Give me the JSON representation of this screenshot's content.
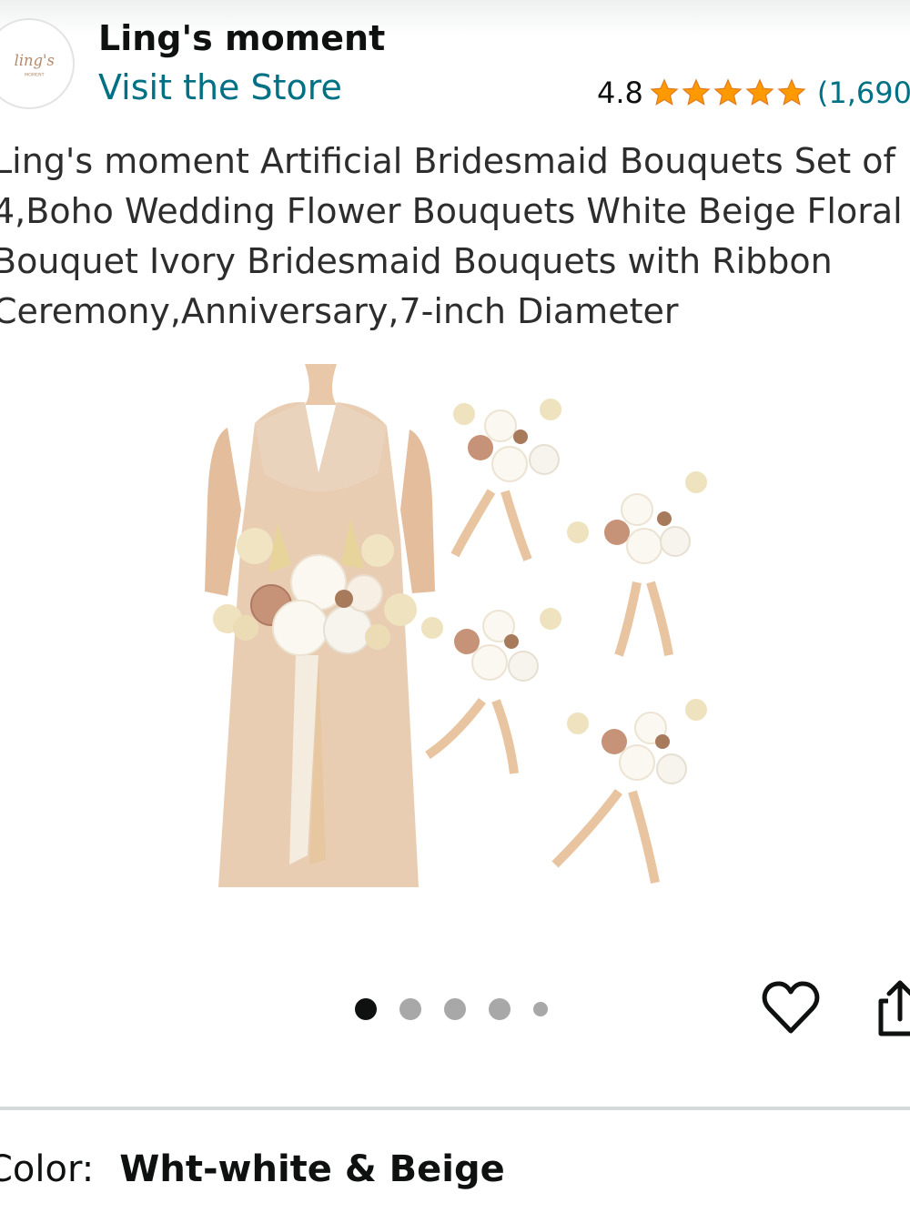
{
  "store": {
    "name": "Ling's moment",
    "visit_label": "Visit the Store",
    "logo_text": "ling's",
    "logo_subtext": "MOMENT"
  },
  "rating": {
    "value": "4.8",
    "stars": 5,
    "count_text": "(1,690"
  },
  "product": {
    "title_lines": [
      "Ling's moment Artificial Bridesmaid Bouquets Set of",
      "4,Boho Wedding Flower Bouquets White Beige Floral",
      "Bouquet Ivory Bridesmaid Bouquets with Ribbon",
      "Ceremony,Anniversary,7-inch Diameter"
    ]
  },
  "carousel": {
    "total": 5,
    "active_index": 0
  },
  "actions": {
    "favorite_icon": "heart-outline-icon",
    "share_icon": "share-icon"
  },
  "variation": {
    "label": "Color:",
    "value": "Wht-white & Beige"
  },
  "colors": {
    "link": "#007185",
    "star": "#ff9900",
    "text": "#0f1111",
    "divider": "#d5d9d9"
  }
}
